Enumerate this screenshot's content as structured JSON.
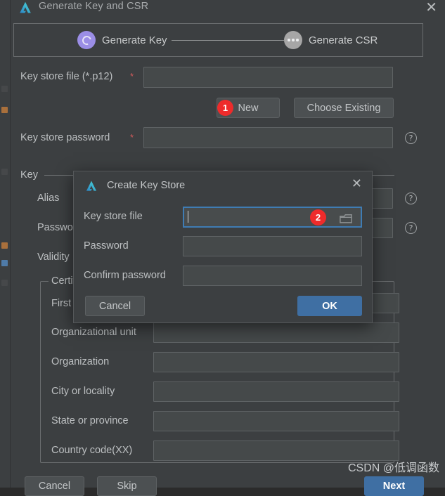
{
  "wizard": {
    "title": "Generate Key and CSR",
    "app_icon": "android-studio-icon",
    "close_label": "✕",
    "stepper": {
      "steps": [
        {
          "label": "Generate Key",
          "state": "active",
          "icon": "spinner-ring-icon"
        },
        {
          "label": "Generate CSR",
          "state": "inactive",
          "icon": "ellipsis-icon"
        }
      ]
    },
    "fields": {
      "key_store_file": {
        "label": "Key store file (*.p12)",
        "required": "*",
        "value": ""
      },
      "key_store_password": {
        "label": "Key store password",
        "required": "*",
        "value": "",
        "help": "?"
      }
    },
    "buttons": {
      "new": {
        "label": "New",
        "badge": "1"
      },
      "choose_existing": {
        "label": "Choose Existing"
      }
    },
    "key_section": {
      "title": "Key",
      "rows": [
        {
          "label": "Alias",
          "value": "",
          "help": "?"
        },
        {
          "label": "Password",
          "value": "",
          "help": "?"
        },
        {
          "label": "Validity",
          "value": ""
        }
      ]
    },
    "certificate_group": {
      "title": "Certificate",
      "rows": [
        {
          "label": "First and last name",
          "value": ""
        },
        {
          "label": "Organizational unit",
          "value": ""
        },
        {
          "label": "Organization",
          "value": ""
        },
        {
          "label": "City or locality",
          "value": ""
        },
        {
          "label": "State or province",
          "value": ""
        },
        {
          "label": "Country code(XX)",
          "value": ""
        }
      ]
    },
    "footer": {
      "cancel": "Cancel",
      "skip": "Skip",
      "next": "Next"
    }
  },
  "modal": {
    "title": "Create Key Store",
    "app_icon": "android-studio-icon",
    "close_label": "✕",
    "fields": {
      "key_store_file": {
        "label": "Key store file",
        "value": "",
        "focused": true,
        "badge": "2",
        "browse_icon": "folder-icon"
      },
      "password": {
        "label": "Password",
        "value": ""
      },
      "confirm_password": {
        "label": "Confirm password",
        "value": ""
      }
    },
    "buttons": {
      "cancel": "Cancel",
      "ok": "OK"
    }
  },
  "watermark": {
    "text": "CSDN @低调函数"
  },
  "colors": {
    "window_bg": "#3c3f41",
    "field_bg": "#45494a",
    "accent_blue": "#3f6fa3",
    "focus_border": "#3f7cb3",
    "badge_red": "#ee2b2b",
    "step_active": "#9b8ee6",
    "step_inactive": "#a6a6a6",
    "required_red": "#d15b5b",
    "text": "#bdc0c2"
  }
}
